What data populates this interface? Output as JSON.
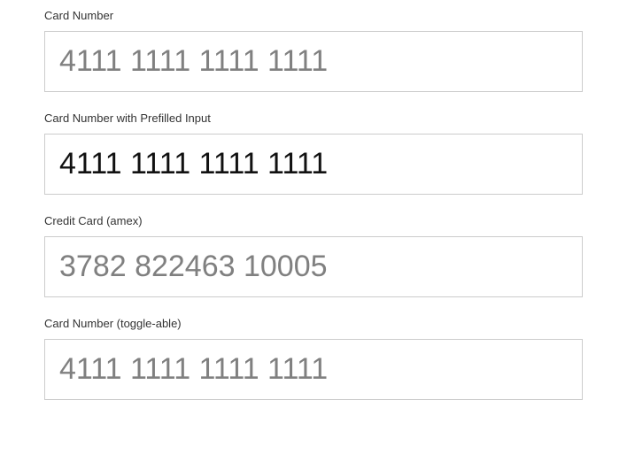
{
  "fields": [
    {
      "label": "Card Number",
      "placeholder": "4111 1111 1111 1111",
      "value": ""
    },
    {
      "label": "Card Number with Prefilled Input",
      "placeholder": "4111 1111 1111 1111",
      "value": "4111 1111 1111 1111"
    },
    {
      "label": "Credit Card (amex)",
      "placeholder": "3782 822463 10005",
      "value": ""
    },
    {
      "label": "Card Number (toggle-able)",
      "placeholder": "4111 1111 1111 1111",
      "value": ""
    }
  ]
}
